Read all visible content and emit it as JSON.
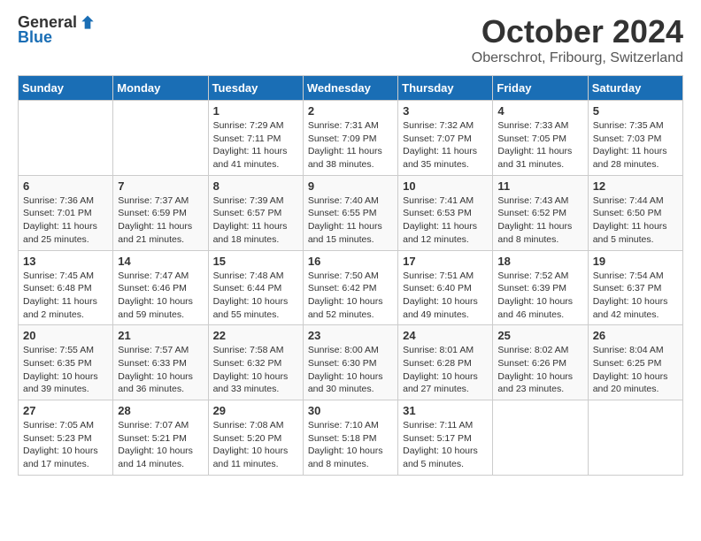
{
  "header": {
    "logo_general": "General",
    "logo_blue": "Blue",
    "month_title": "October 2024",
    "location": "Oberschrot, Fribourg, Switzerland"
  },
  "columns": [
    "Sunday",
    "Monday",
    "Tuesday",
    "Wednesday",
    "Thursday",
    "Friday",
    "Saturday"
  ],
  "weeks": [
    [
      {
        "day": "",
        "sunrise": "",
        "sunset": "",
        "daylight": ""
      },
      {
        "day": "",
        "sunrise": "",
        "sunset": "",
        "daylight": ""
      },
      {
        "day": "1",
        "sunrise": "Sunrise: 7:29 AM",
        "sunset": "Sunset: 7:11 PM",
        "daylight": "Daylight: 11 hours and 41 minutes."
      },
      {
        "day": "2",
        "sunrise": "Sunrise: 7:31 AM",
        "sunset": "Sunset: 7:09 PM",
        "daylight": "Daylight: 11 hours and 38 minutes."
      },
      {
        "day": "3",
        "sunrise": "Sunrise: 7:32 AM",
        "sunset": "Sunset: 7:07 PM",
        "daylight": "Daylight: 11 hours and 35 minutes."
      },
      {
        "day": "4",
        "sunrise": "Sunrise: 7:33 AM",
        "sunset": "Sunset: 7:05 PM",
        "daylight": "Daylight: 11 hours and 31 minutes."
      },
      {
        "day": "5",
        "sunrise": "Sunrise: 7:35 AM",
        "sunset": "Sunset: 7:03 PM",
        "daylight": "Daylight: 11 hours and 28 minutes."
      }
    ],
    [
      {
        "day": "6",
        "sunrise": "Sunrise: 7:36 AM",
        "sunset": "Sunset: 7:01 PM",
        "daylight": "Daylight: 11 hours and 25 minutes."
      },
      {
        "day": "7",
        "sunrise": "Sunrise: 7:37 AM",
        "sunset": "Sunset: 6:59 PM",
        "daylight": "Daylight: 11 hours and 21 minutes."
      },
      {
        "day": "8",
        "sunrise": "Sunrise: 7:39 AM",
        "sunset": "Sunset: 6:57 PM",
        "daylight": "Daylight: 11 hours and 18 minutes."
      },
      {
        "day": "9",
        "sunrise": "Sunrise: 7:40 AM",
        "sunset": "Sunset: 6:55 PM",
        "daylight": "Daylight: 11 hours and 15 minutes."
      },
      {
        "day": "10",
        "sunrise": "Sunrise: 7:41 AM",
        "sunset": "Sunset: 6:53 PM",
        "daylight": "Daylight: 11 hours and 12 minutes."
      },
      {
        "day": "11",
        "sunrise": "Sunrise: 7:43 AM",
        "sunset": "Sunset: 6:52 PM",
        "daylight": "Daylight: 11 hours and 8 minutes."
      },
      {
        "day": "12",
        "sunrise": "Sunrise: 7:44 AM",
        "sunset": "Sunset: 6:50 PM",
        "daylight": "Daylight: 11 hours and 5 minutes."
      }
    ],
    [
      {
        "day": "13",
        "sunrise": "Sunrise: 7:45 AM",
        "sunset": "Sunset: 6:48 PM",
        "daylight": "Daylight: 11 hours and 2 minutes."
      },
      {
        "day": "14",
        "sunrise": "Sunrise: 7:47 AM",
        "sunset": "Sunset: 6:46 PM",
        "daylight": "Daylight: 10 hours and 59 minutes."
      },
      {
        "day": "15",
        "sunrise": "Sunrise: 7:48 AM",
        "sunset": "Sunset: 6:44 PM",
        "daylight": "Daylight: 10 hours and 55 minutes."
      },
      {
        "day": "16",
        "sunrise": "Sunrise: 7:50 AM",
        "sunset": "Sunset: 6:42 PM",
        "daylight": "Daylight: 10 hours and 52 minutes."
      },
      {
        "day": "17",
        "sunrise": "Sunrise: 7:51 AM",
        "sunset": "Sunset: 6:40 PM",
        "daylight": "Daylight: 10 hours and 49 minutes."
      },
      {
        "day": "18",
        "sunrise": "Sunrise: 7:52 AM",
        "sunset": "Sunset: 6:39 PM",
        "daylight": "Daylight: 10 hours and 46 minutes."
      },
      {
        "day": "19",
        "sunrise": "Sunrise: 7:54 AM",
        "sunset": "Sunset: 6:37 PM",
        "daylight": "Daylight: 10 hours and 42 minutes."
      }
    ],
    [
      {
        "day": "20",
        "sunrise": "Sunrise: 7:55 AM",
        "sunset": "Sunset: 6:35 PM",
        "daylight": "Daylight: 10 hours and 39 minutes."
      },
      {
        "day": "21",
        "sunrise": "Sunrise: 7:57 AM",
        "sunset": "Sunset: 6:33 PM",
        "daylight": "Daylight: 10 hours and 36 minutes."
      },
      {
        "day": "22",
        "sunrise": "Sunrise: 7:58 AM",
        "sunset": "Sunset: 6:32 PM",
        "daylight": "Daylight: 10 hours and 33 minutes."
      },
      {
        "day": "23",
        "sunrise": "Sunrise: 8:00 AM",
        "sunset": "Sunset: 6:30 PM",
        "daylight": "Daylight: 10 hours and 30 minutes."
      },
      {
        "day": "24",
        "sunrise": "Sunrise: 8:01 AM",
        "sunset": "Sunset: 6:28 PM",
        "daylight": "Daylight: 10 hours and 27 minutes."
      },
      {
        "day": "25",
        "sunrise": "Sunrise: 8:02 AM",
        "sunset": "Sunset: 6:26 PM",
        "daylight": "Daylight: 10 hours and 23 minutes."
      },
      {
        "day": "26",
        "sunrise": "Sunrise: 8:04 AM",
        "sunset": "Sunset: 6:25 PM",
        "daylight": "Daylight: 10 hours and 20 minutes."
      }
    ],
    [
      {
        "day": "27",
        "sunrise": "Sunrise: 7:05 AM",
        "sunset": "Sunset: 5:23 PM",
        "daylight": "Daylight: 10 hours and 17 minutes."
      },
      {
        "day": "28",
        "sunrise": "Sunrise: 7:07 AM",
        "sunset": "Sunset: 5:21 PM",
        "daylight": "Daylight: 10 hours and 14 minutes."
      },
      {
        "day": "29",
        "sunrise": "Sunrise: 7:08 AM",
        "sunset": "Sunset: 5:20 PM",
        "daylight": "Daylight: 10 hours and 11 minutes."
      },
      {
        "day": "30",
        "sunrise": "Sunrise: 7:10 AM",
        "sunset": "Sunset: 5:18 PM",
        "daylight": "Daylight: 10 hours and 8 minutes."
      },
      {
        "day": "31",
        "sunrise": "Sunrise: 7:11 AM",
        "sunset": "Sunset: 5:17 PM",
        "daylight": "Daylight: 10 hours and 5 minutes."
      },
      {
        "day": "",
        "sunrise": "",
        "sunset": "",
        "daylight": ""
      },
      {
        "day": "",
        "sunrise": "",
        "sunset": "",
        "daylight": ""
      }
    ]
  ]
}
